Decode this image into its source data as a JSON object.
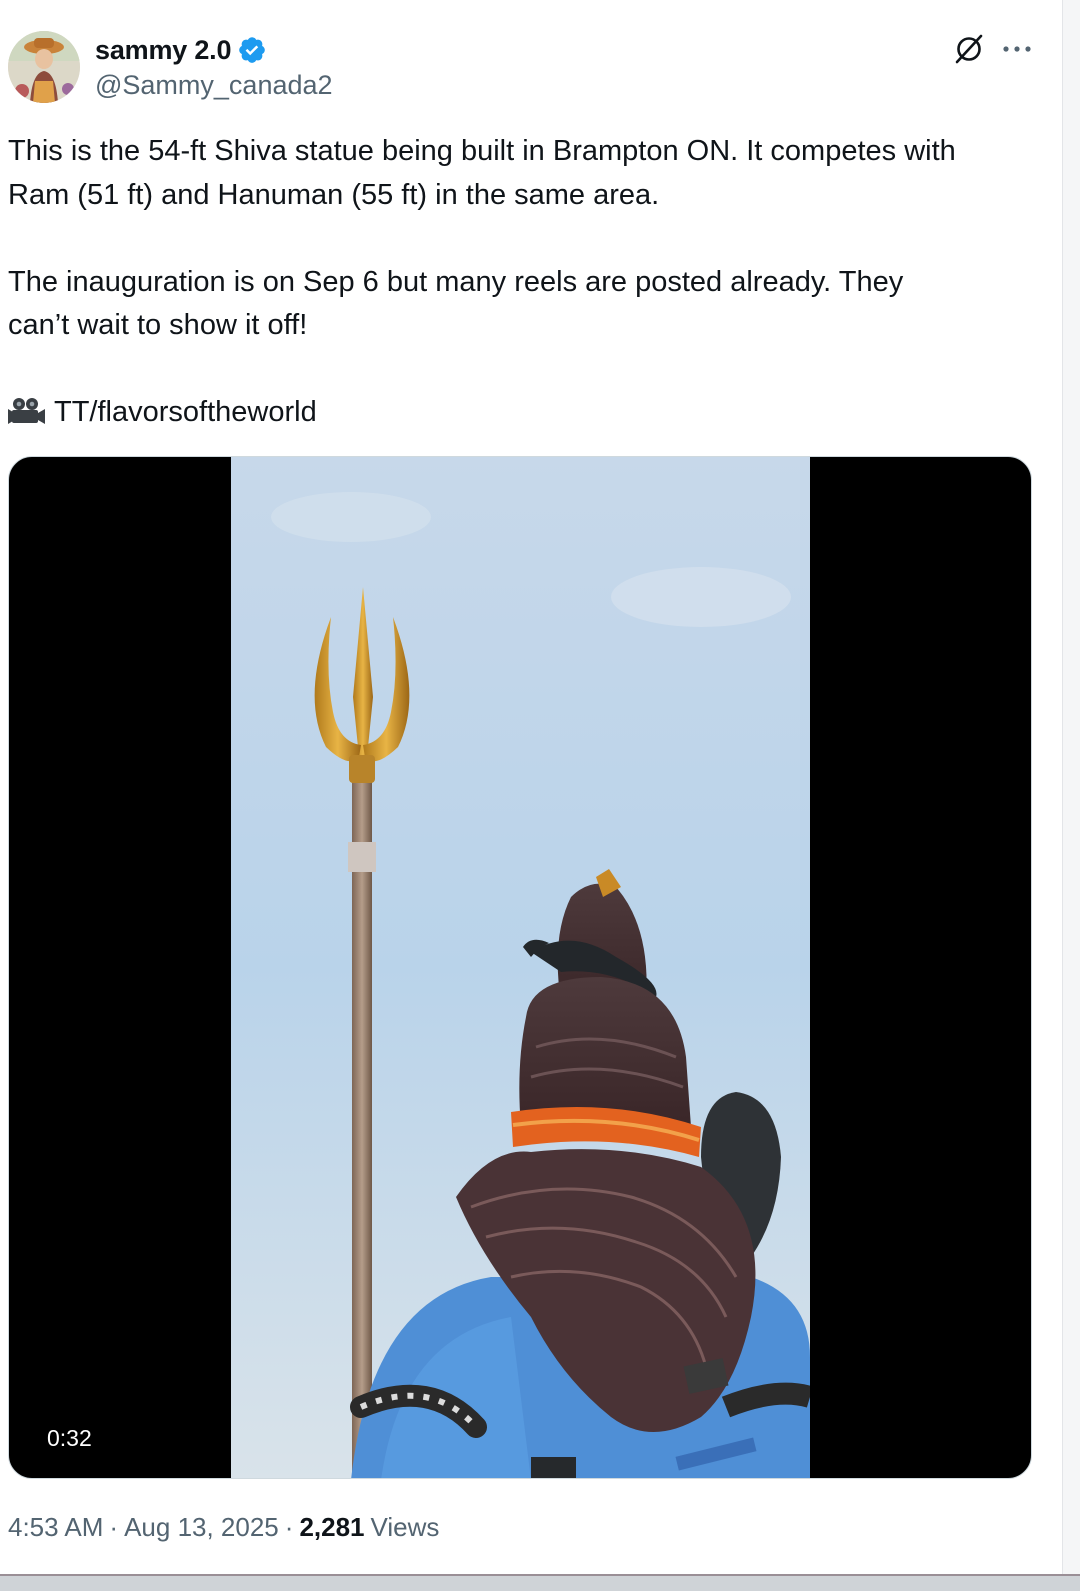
{
  "author": {
    "display_name": "sammy 2.0",
    "handle": "@Sammy_canada2",
    "verified_icon": "verified-badge-icon",
    "accent_color": "#1d9bf0"
  },
  "header_actions": {
    "grok_icon": "grok-icon",
    "more_icon": "more-horizontal-icon"
  },
  "tweet": {
    "line_1": "This is the 54-ft Shiva statue being built in Brampton ON. It competes with",
    "line_2": "Ram (51 ft) and Hanuman (55 ft) in the same area.",
    "line_3": "The inauguration is on Sep 6 but many reels are posted already. They",
    "line_4": "can’t wait to show it off!",
    "credit_icon": "movie-camera-icon",
    "credit": "TT/flavorsoftheworld"
  },
  "media": {
    "duration": "0:32"
  },
  "meta": {
    "time": "4:53 AM",
    "sep1": "·",
    "date": "Aug 13, 2025",
    "sep2": "·",
    "views_count": "2,281",
    "views_label": "Views"
  }
}
